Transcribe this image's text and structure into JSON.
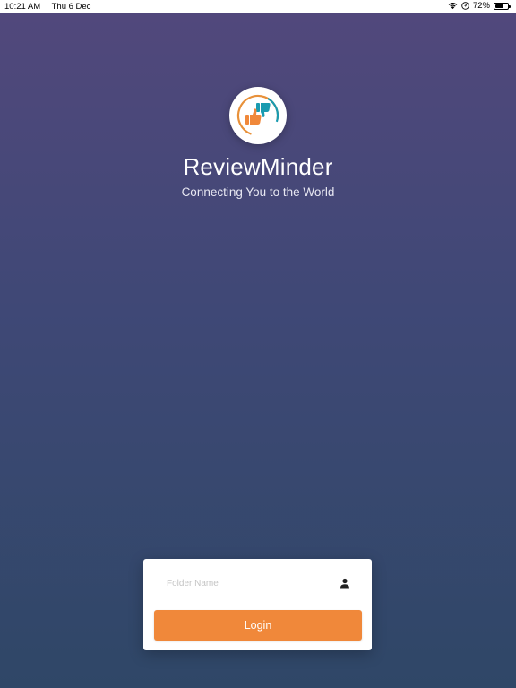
{
  "status_bar": {
    "time": "10:21 AM",
    "date": "Thu 6 Dec",
    "battery_percent": "72%",
    "battery_level": 0.72,
    "icons": [
      "wifi-icon",
      "location-icon",
      "battery-icon"
    ]
  },
  "branding": {
    "logo_icon": "thumbs-up-down-logo-icon",
    "app_name": "ReviewMinder",
    "tagline": "Connecting You to the World"
  },
  "login": {
    "folder_placeholder": "Folder Name",
    "folder_value": "",
    "user_icon": "user-icon",
    "button_label": "Login"
  },
  "colors": {
    "accent": "#f0883a",
    "logo_teal": "#1a9bb0",
    "background_top": "#52487c",
    "background_bottom": "#2f4767"
  }
}
